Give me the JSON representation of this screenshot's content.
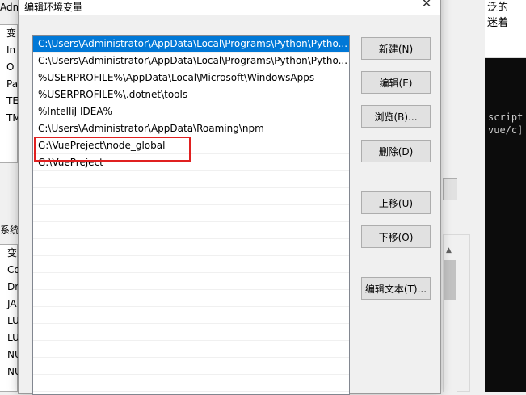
{
  "background": {
    "title": "Adm",
    "top_rows": [
      "变",
      "In",
      "O",
      "Pa",
      "TE",
      "TM"
    ],
    "system_label": "系统",
    "bottom_rows": [
      "变",
      "Co",
      "Dr",
      "JA",
      "LU",
      "LU",
      "NU",
      "NU"
    ],
    "right_text_lines": [
      "泛的",
      "迷着"
    ],
    "terminal_lines": [
      "script",
      "vue/c]"
    ]
  },
  "dialog": {
    "title": "编辑环境变量",
    "close_glyph": "✕",
    "entries": [
      "C:\\Users\\Administrator\\AppData\\Local\\Programs\\Python\\Pytho...",
      "C:\\Users\\Administrator\\AppData\\Local\\Programs\\Python\\Pytho...",
      "%USERPROFILE%\\AppData\\Local\\Microsoft\\WindowsApps",
      "%USERPROFILE%\\.dotnet\\tools",
      "%IntelliJ IDEA%",
      "C:\\Users\\Administrator\\AppData\\Roaming\\npm",
      "G:\\VuePreject\\node_global",
      "G:\\VuePreject"
    ],
    "selected_index": 0,
    "highlighted_index": 6,
    "buttons": {
      "new": "新建(N)",
      "edit": "编辑(E)",
      "browse": "浏览(B)...",
      "delete": "删除(D)",
      "move_up": "上移(U)",
      "move_down": "下移(O)",
      "edit_text": "编辑文本(T)..."
    }
  },
  "colors": {
    "selection": "#0078d7",
    "highlight_box": "#e02020"
  }
}
